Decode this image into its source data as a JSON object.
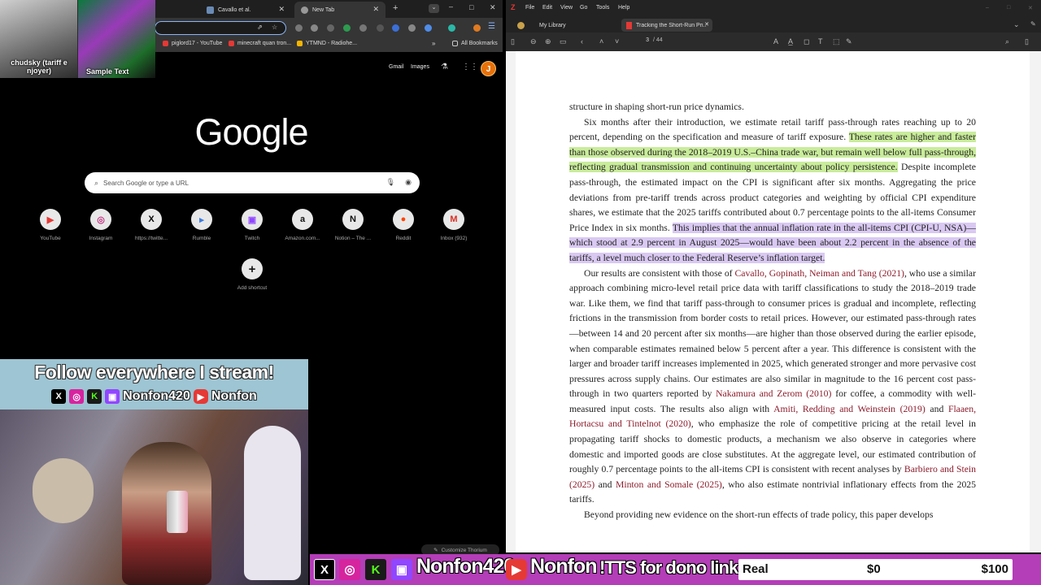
{
  "chrome": {
    "tabs": [
      {
        "label": "Cavallo et al."
      },
      {
        "label": "New Tab"
      }
    ],
    "bookmarks": [
      {
        "label": "piglord17 - YouTube"
      },
      {
        "label": "minecraft quan tron..."
      },
      {
        "label": "YTMND - Radiohe..."
      },
      {
        "label": "All Bookmarks"
      }
    ],
    "top_links": {
      "gmail": "Gmail",
      "images": "Images",
      "avatar_letter": "J"
    },
    "logo": "Google",
    "search_placeholder": "Search Google or type a URL",
    "shortcuts": [
      {
        "label": "YouTube",
        "glyph": "▶"
      },
      {
        "label": "Instagram",
        "glyph": "◎"
      },
      {
        "label": "https://twitte...",
        "glyph": "X"
      },
      {
        "label": "Rumble",
        "glyph": "▸"
      },
      {
        "label": "Twitch",
        "glyph": "▣"
      },
      {
        "label": "Amazon.com...",
        "glyph": "a"
      },
      {
        "label": "Notion – The ...",
        "glyph": "N"
      },
      {
        "label": "Reddit",
        "glyph": "●"
      },
      {
        "label": "Inbox (932)",
        "glyph": "M"
      }
    ],
    "add_shortcut": "Add shortcut",
    "customize": "Customize Thorium"
  },
  "zotero": {
    "menu": [
      "File",
      "Edit",
      "View",
      "Go",
      "Tools",
      "Help"
    ],
    "tabs": [
      {
        "label": "My Library"
      },
      {
        "label": "Tracking the Short-Run Pri..."
      }
    ],
    "page_current": "3",
    "page_total": "/ 44",
    "paper": {
      "p0": "structure in shaping short-run price dynamics.",
      "p1_a": "Six months after their introduction, we estimate retail tariff pass-through rates reaching up to 20 percent, depending on the specification and measure of tariff exposure. ",
      "p1_hl1": "These rates are higher and faster than those observed during the 2018–2019 U.S.–China trade war, but remain well below full pass-through, reflecting gradual transmission and continuing uncertainty about policy persistence.",
      "p1_b": " Despite incomplete pass-through, the estimated impact on the CPI is significant after six months. Aggregating the price deviations from pre-tariff trends across product categories and weighting by official CPI expenditure shares, we estimate that the 2025 tariffs contributed about 0.7 percentage points to the all-items Consumer Price Index in six months. ",
      "p1_hl2": "This implies that the annual inflation rate in the all-items CPI (CPI-U, NSA)—which stood at 2.9 percent in August 2025—would have been about 2.2 percent in the absence of the tariffs, a level much closer to the Federal Reserve’s inflation target.",
      "p2_a": "Our results are consistent with those of ",
      "c1": "Cavallo, Gopinath, Neiman and Tang (2021)",
      "p2_b": ", who use a similar approach combining micro-level retail price data with tariff classifications to study the 2018–2019 trade war. Like them, we find that tariff pass-through to consumer prices is gradual and incomplete, reflecting frictions in the transmission from border costs to retail prices. However, our estimated pass-through rates—between 14 and 20 percent after six months—are higher than those observed during the earlier episode, when comparable estimates remained below 5 percent after a year. This difference is consistent with the larger and broader tariff increases implemented in 2025, which generated stronger and more pervasive cost pressures across supply chains. Our estimates are also similar in magnitude to the 16 percent cost pass-through in two quarters reported by ",
      "c2": "Nakamura and Zerom (2010)",
      "p2_c": " for coffee, a commodity with well-measured input costs. The results also align with ",
      "c3": "Amiti, Redding and Weinstein (2019)",
      "p2_d": " and ",
      "c4": "Flaaen, Hortacsu and Tintelnot (2020)",
      "p2_e": ", who emphasize the role of competitive pricing at the retail level in propagating tariff shocks to domestic products, a mechanism we also observe in categories where domestic and imported goods are close substitutes. At the aggregate level, our estimated contribution of roughly 0.7 percentage points to the all-items CPI is consistent with recent analyses by ",
      "c5": "Barbiero and Stein (2025)",
      "p2_f": " and ",
      "c6": "Minton and Somale (2025)",
      "p2_g": ", who also estimate nontrivial inflationary effects from the 2025 tariffs.",
      "p3": "Beyond providing new evidence on the short-run effects of trade policy, this paper develops"
    }
  },
  "overlay": {
    "cam_left_caption": "chudsky (tariff e njoyer)",
    "cam_right_caption": "Sample Text",
    "follow_title": "Follow everywhere I stream!",
    "follow_handle_1": "Nonfon420",
    "follow_handle_2": "Nonfon",
    "bar_handle_1": "Nonfon420",
    "bar_handle_2": "Nonfon",
    "bar_tts": "!TTS for dono link",
    "goal_label": "Real",
    "goal_current": "$0",
    "goal_target": "$100"
  }
}
